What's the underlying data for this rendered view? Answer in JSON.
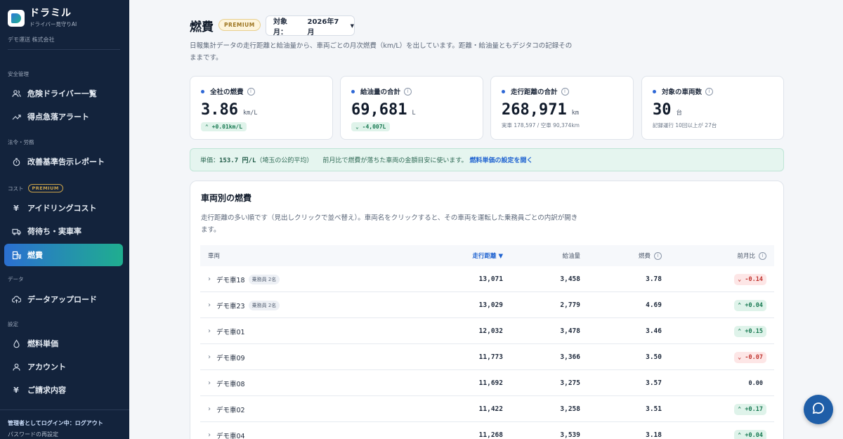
{
  "sidebar": {
    "brand_name": "ドラミル",
    "brand_sub": "ドライバー見守りAI",
    "company": "デモ運送 株式会社",
    "sections": {
      "safety": "安全管理",
      "law": "法令・労務",
      "cost": "コスト",
      "cost_badge": "PREMIUM",
      "data": "データ",
      "settings": "設定"
    },
    "items": [
      {
        "label": "危険ドライバー一覧",
        "icon": "users-icon"
      },
      {
        "label": "得点急落アラート",
        "icon": "trend-icon"
      },
      {
        "label": "改善基準告示レポート",
        "icon": "stopwatch-icon"
      },
      {
        "label": "アイドリングコスト",
        "icon": "yen-icon"
      },
      {
        "label": "荷待ち・実車率",
        "icon": "truck-icon"
      },
      {
        "label": "燃費",
        "icon": "fuel-icon"
      },
      {
        "label": "データアップロード",
        "icon": "cloud-upload-icon"
      },
      {
        "label": "燃料単価",
        "icon": "drop-icon"
      },
      {
        "label": "アカウント",
        "icon": "user-icon"
      },
      {
        "label": "ご請求内容",
        "icon": "yen-icon"
      }
    ],
    "login_status": "管理者としてログイン中：ログアウト",
    "password_reset": "パスワードの再設定"
  },
  "header": {
    "title": "燃費",
    "badge": "PREMIUM",
    "month_label": "対象月：",
    "month_value": "2026年7月",
    "description": "日報集計データの走行距離と給油量から、車両ごとの月次燃費（km/L）を出しています。距離・給油量ともデジタコの記録そのままです。"
  },
  "kpis": [
    {
      "label": "全社の燃費",
      "value": "3.86",
      "unit": "km/L",
      "delta": "+0.01km/L",
      "delta_dir": "up"
    },
    {
      "label": "給油量の合計",
      "value": "69,681",
      "unit": "L",
      "delta": "-4,007L",
      "delta_dir": "up"
    },
    {
      "label": "走行距離の合計",
      "value": "268,971",
      "unit": "km",
      "note": "実車 178,597 / 空車 90,374km"
    },
    {
      "label": "対象の車両数",
      "value": "30",
      "unit": "台",
      "note": "記録運行 10回以上が 27台"
    }
  ],
  "price_banner": {
    "prefix": "単価：",
    "price": "153.7 円/L",
    "source": "（埼玉の公的平均）",
    "message": "前月比で燃費が落ちた車両の金額目安に使います。",
    "link": "燃料単価の設定を開く"
  },
  "vehicle_table": {
    "title": "車両別の燃費",
    "description": "走行距離の多い順です（見出しクリックで並べ替え）。車両名をクリックすると、その車両を運転した乗務員ごとの内訳が開きます。",
    "columns": {
      "vehicle": "車両",
      "distance": "走行距離 ▼",
      "fuel": "給油量",
      "efficiency": "燃費",
      "change": "前月比"
    },
    "rows": [
      {
        "name": "デモ車18",
        "crew": "乗務員 2名",
        "distance": "13,071",
        "fuel": "3,458",
        "efficiency": "3.78",
        "change": "-0.14",
        "dir": "down"
      },
      {
        "name": "デモ車23",
        "crew": "乗務員 2名",
        "distance": "13,029",
        "fuel": "2,779",
        "efficiency": "4.69",
        "change": "+0.04",
        "dir": "up"
      },
      {
        "name": "デモ車01",
        "crew": "",
        "distance": "12,032",
        "fuel": "3,478",
        "efficiency": "3.46",
        "change": "+0.15",
        "dir": "up"
      },
      {
        "name": "デモ車09",
        "crew": "",
        "distance": "11,773",
        "fuel": "3,366",
        "efficiency": "3.50",
        "change": "-0.07",
        "dir": "down"
      },
      {
        "name": "デモ車08",
        "crew": "",
        "distance": "11,692",
        "fuel": "3,275",
        "efficiency": "3.57",
        "change": "0.00",
        "dir": "flat"
      },
      {
        "name": "デモ車02",
        "crew": "",
        "distance": "11,422",
        "fuel": "3,258",
        "efficiency": "3.51",
        "change": "+0.17",
        "dir": "up"
      },
      {
        "name": "デモ車04",
        "crew": "",
        "distance": "11,268",
        "fuel": "3,539",
        "efficiency": "3.18",
        "change": "+0.04",
        "dir": "up"
      }
    ]
  },
  "colors": {
    "sidebar_bg": "#13233c",
    "accent_blue": "#2b6fd1",
    "accent_green": "#1fae8f",
    "up": "#197a52",
    "down": "#c0342f"
  }
}
